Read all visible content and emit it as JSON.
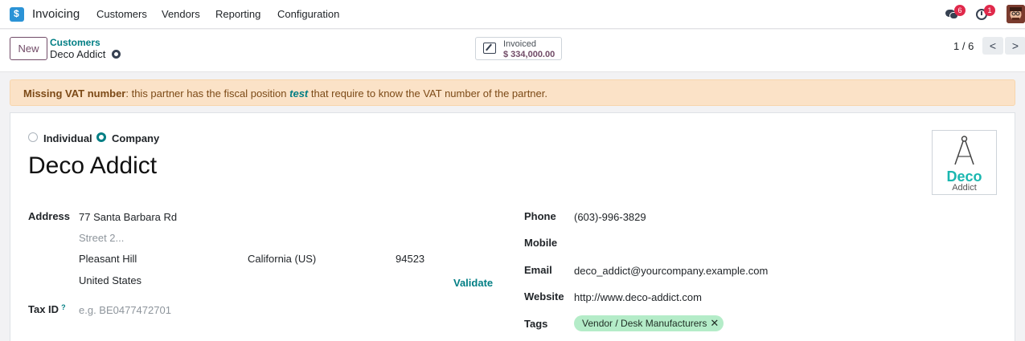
{
  "navbar": {
    "app_name": "Invoicing",
    "menu": [
      "Customers",
      "Vendors",
      "Reporting",
      "Configuration"
    ],
    "chat_badge": "6",
    "activity_badge": "1"
  },
  "control": {
    "new_label": "New",
    "breadcrumb_parent": "Customers",
    "breadcrumb_current": "Deco Addict",
    "stat": {
      "label": "Invoiced",
      "value": "$ 334,000.00"
    },
    "pager": "1 / 6",
    "pager_prev": "<",
    "pager_next": ">"
  },
  "alert": {
    "strong": "Missing VAT number",
    "before": ": this partner has the fiscal position ",
    "link": "test",
    "after": " that require to know the VAT number of the partner."
  },
  "form": {
    "company_type": {
      "individual": "Individual",
      "company": "Company",
      "selected": "Company"
    },
    "name": "Deco Addict",
    "logo": {
      "line1": "Deco",
      "line2": "Addict"
    },
    "address_label": "Address",
    "street": "77 Santa Barbara Rd",
    "street2_placeholder": "Street 2...",
    "city": "Pleasant Hill",
    "state": "California (US)",
    "zip": "94523",
    "country": "United States",
    "validate_label": "Validate",
    "taxid_label": "Tax ID",
    "taxid_help": "?",
    "taxid_placeholder": "e.g. BE0477472701",
    "phone_label": "Phone",
    "phone": "(603)-996-3829",
    "mobile_label": "Mobile",
    "mobile": "",
    "email_label": "Email",
    "email": "deco_addict@yourcompany.example.com",
    "website_label": "Website",
    "website": "http://www.deco-addict.com",
    "tags_label": "Tags",
    "tags": [
      "Vendor / Desk Manufacturers"
    ],
    "tag_remove": "✕"
  },
  "colors": {
    "primary": "#714b67",
    "link": "#017e84",
    "alert_bg": "#fbe2c7",
    "tag_bg": "#b4ecc8",
    "badge": "#e0294b"
  }
}
